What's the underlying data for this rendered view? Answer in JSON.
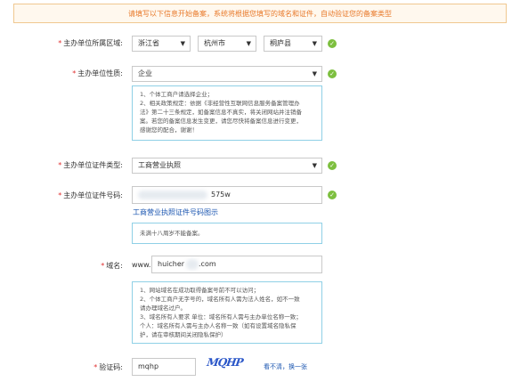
{
  "banner": "请填写以下信息开始备案，系统将根据您填写的域名和证件，自动验证您的备案类型",
  "region": {
    "label": "主办单位所属区域:",
    "province": "浙江省",
    "city": "杭州市",
    "county": "桐庐县"
  },
  "nature": {
    "label": "主办单位性质:",
    "value": "企业",
    "tip": [
      "1、个体工商户请选择企业；",
      "2、相关政策规定：依据《非经营性互联网信息服务备案管理办",
      "法》第二十三条规定，如备案信息不真实，将关闭网站并注销备",
      "案。若您的备案信息发生变更，请您尽快将备案信息进行变更，",
      "感谢您的配合，谢谢！"
    ]
  },
  "cert_type": {
    "label": "主办单位证件类型:",
    "value": "工商营业执照"
  },
  "cert_no": {
    "label": "主办单位证件号码:",
    "value": "575w",
    "link": "工商营业执照证件号码图示",
    "tip": "未满十八周岁不能备案。"
  },
  "domain": {
    "label": "域名:",
    "prefix": "www.",
    "value": "huicher",
    "suffix": ".com",
    "tip": [
      "1、网站域名在成功取得备案号前不可以访问；",
      "2、个体工商户无字号的，域名所有人需为法人姓名，如不一致",
      "请办理域名过户。",
      "3、域名所有人要求 单位：域名所有人需与主办单位名称一致；",
      "个人：域名所有人需与主办人名称一致（如有设置域名隐私保",
      "护，请在审核期间关闭隐私保护）"
    ]
  },
  "captcha": {
    "label": "验证码:",
    "value": "mqhp",
    "image_text": "MQHP",
    "refresh": "看不清，换一张"
  },
  "colors": {
    "accent": "#e8792a",
    "check": "#7dbf3f",
    "link": "#1a55b0",
    "tip_border": "#8fd0e6"
  }
}
